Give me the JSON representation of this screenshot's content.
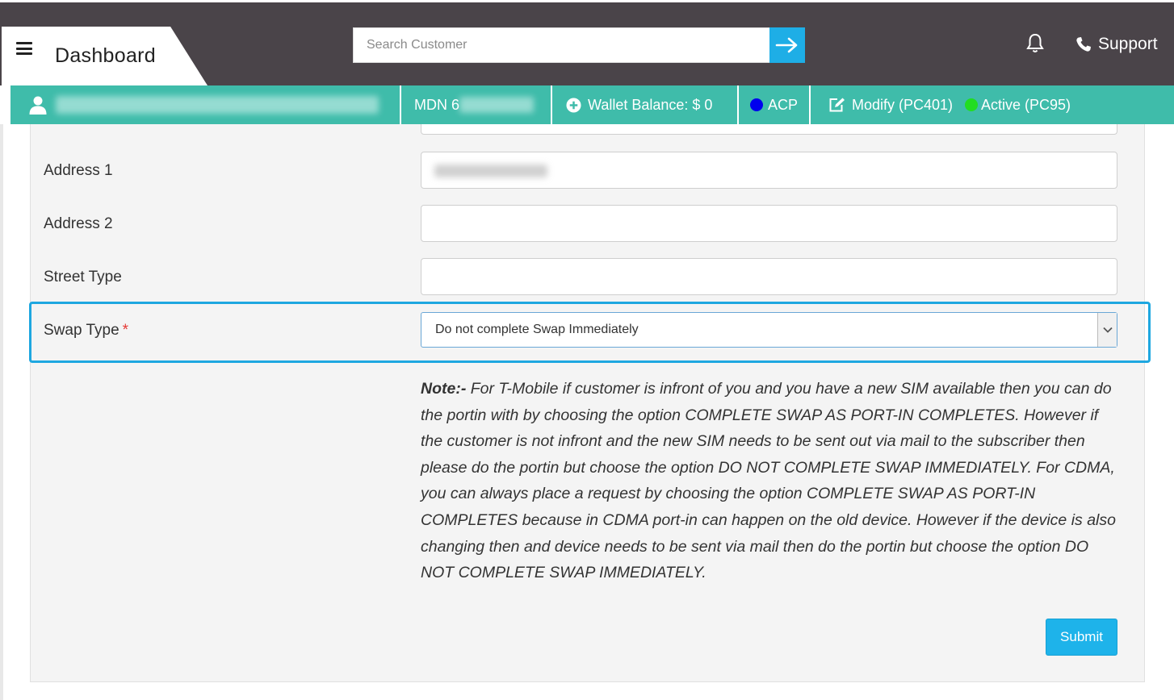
{
  "header": {
    "title": "Dashboard",
    "search_placeholder": "Search Customer",
    "support_label": "Support"
  },
  "infobar": {
    "mdn_label": "MDN 6",
    "wallet_label": "Wallet Balance: $ 0",
    "acp_label": "ACP",
    "modify_label": "Modify (PC401)",
    "active_label": "Active (PC95)",
    "colors": {
      "acp_dot": "#0000ee",
      "active_dot": "#22dd22",
      "bar": "#3fbcaa"
    }
  },
  "form": {
    "address1_label": "Address 1",
    "address2_label": "Address 2",
    "street_type_label": "Street Type",
    "swap_type_label": "Swap Type",
    "required_marker": "*",
    "swap_type_value": "Do not complete Swap Immediately",
    "submit_label": "Submit"
  },
  "note": {
    "prefix": "Note:-",
    "text": " For T-Mobile if customer is infront of you and you have a new SIM available then you can do the portin with by choosing the option COMPLETE SWAP AS PORT-IN COMPLETES. However if the customer is not infront and the new SIM needs to be sent out via mail to the subscriber then please do the portin but choose the option DO NOT COMPLETE SWAP IMMEDIATELY. For CDMA, you can always place a request by choosing the option COMPLETE SWAP AS PORT-IN COMPLETES because in CDMA port-in can happen on the old device. However if the device is also changing then and device needs to be sent via mail then do the portin but choose the option DO NOT COMPLETE SWAP IMMEDIATELY."
  },
  "icons": [
    "hamburger-icon",
    "arrow-right-icon",
    "bell-icon",
    "phone-icon",
    "user-icon",
    "plus-circle-icon",
    "edit-icon",
    "chevron-down-icon"
  ]
}
